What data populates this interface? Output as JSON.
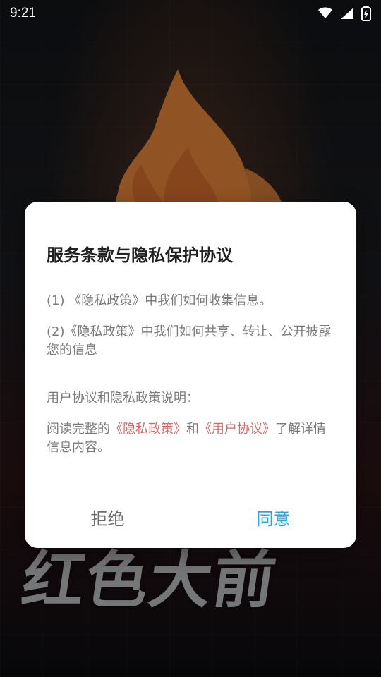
{
  "status_bar": {
    "time": "9:21",
    "icons": [
      "wifi-icon",
      "cellular-signal-icon",
      "battery-charging-icon"
    ]
  },
  "background": {
    "title_text": "红色大前",
    "accent_color": "#ff7a2f"
  },
  "dialog": {
    "title": "服务条款与隐私保护协议",
    "items": [
      "(1) 《隐私政策》中我们如何收集信息。",
      "(2)《隐私政策》中我们如何共享、转让、公开披露您的信息"
    ],
    "section_label": "用户协议和隐私政策说明：",
    "read_prefix": "阅读完整的",
    "privacy_link": "《隐私政策》",
    "and_text": "和",
    "user_link": "《用户协议》",
    "read_suffix": "了解详情信息内容。",
    "buttons": {
      "reject": "拒绝",
      "agree": "同意"
    },
    "colors": {
      "link": "#d46a6a",
      "agree": "#2aa7d8",
      "reject": "#6d6d6d"
    }
  }
}
